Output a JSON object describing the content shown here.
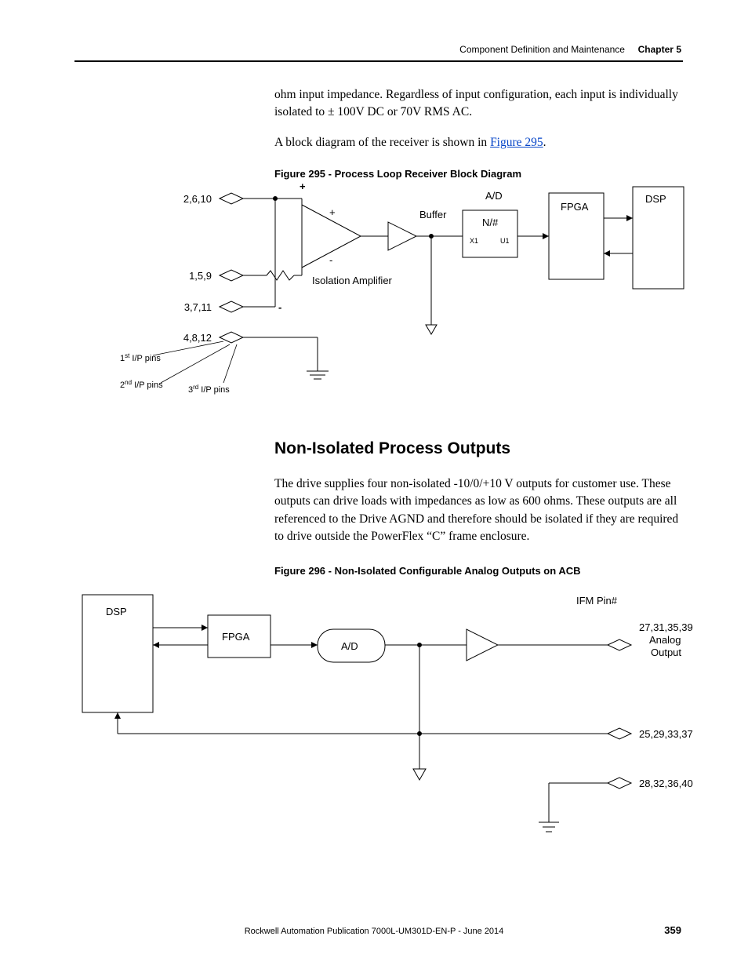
{
  "header": {
    "section": "Component Definition and Maintenance",
    "chapter_label": "Chapter 5"
  },
  "para1": "ohm input impedance. Regardless of input configuration, each input is individually isolated to ± 100V DC or 70V RMS AC.",
  "para2_pre": "A block diagram of the receiver is shown in ",
  "para2_link": "Figure 295",
  "para2_post": ".",
  "fig295_caption": "Figure 295 - Process Loop Receiver Block Diagram",
  "fig295": {
    "plus": "+",
    "minus": "-",
    "pins_a": "2,6,10",
    "pins_b": "1,5,9",
    "pins_c": "3,7,11",
    "pins_d": "4,8,12",
    "iso_amp": "Isolation Amplifier",
    "buffer": "Buffer",
    "ad": "A/D",
    "nhash": "N/#",
    "x1": "X1",
    "u1": "U1",
    "fpga": "FPGA",
    "dsp": "DSP",
    "ip1_pre": "1",
    "ip1_sup": "st",
    "ip1_post": " I/P pins",
    "ip2_pre": "2",
    "ip2_sup": "nd",
    "ip2_post": " I/P pins",
    "ip3_pre": "3",
    "ip3_sup": "rd",
    "ip3_post": " I/P pins"
  },
  "h2": "Non-Isolated Process Outputs",
  "para3": "The drive supplies four non-isolated -10/0/+10 V outputs for customer use. These outputs can drive loads with impedances as low as 600 ohms. These outputs are all referenced to the Drive AGND and therefore should be isolated if they are required to drive outside the PowerFlex “C” frame enclosure.",
  "fig296_caption": "Figure 296 - Non-Isolated Configurable Analog Outputs on ACB",
  "fig296": {
    "dsp": "DSP",
    "fpga": "FPGA",
    "ad": "A/D",
    "ifm": "IFM Pin#",
    "out1a": "27,31,35,39",
    "out1b": "Analog",
    "out1c": "Output",
    "out2": "25,29,33,37",
    "out3": "28,32,36,40"
  },
  "footer": {
    "pub": "Rockwell Automation Publication 7000L-UM301D-EN-P - June 2014",
    "page": "359"
  }
}
